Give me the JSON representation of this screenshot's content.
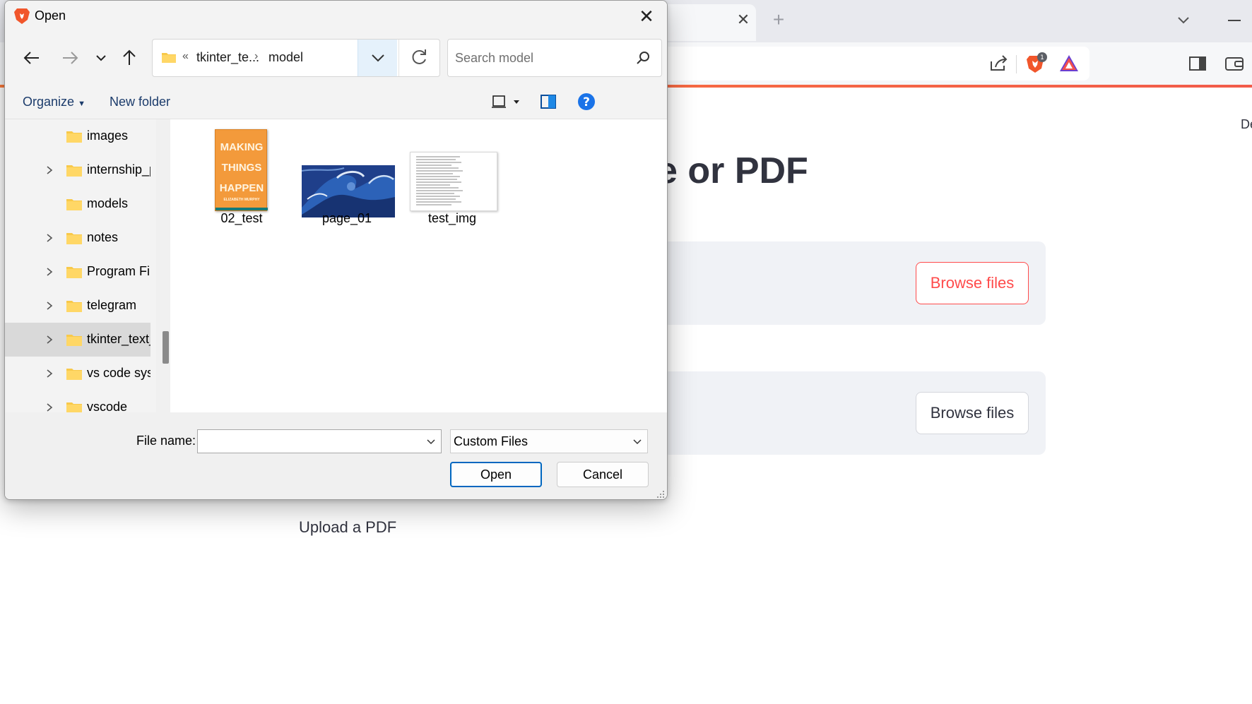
{
  "browser": {
    "tab_close_glyph": "✕",
    "new_tab_glyph": "+",
    "brave_badge": "1"
  },
  "page": {
    "title_fragment": "e or PDF",
    "deploy_fragment": "De",
    "upload_buttons": [
      "Browse files",
      "Browse files"
    ],
    "upload_caption": "Upload a PDF",
    "accent_color": "#ff4b4b"
  },
  "dialog": {
    "title": "Open",
    "address": {
      "overflow": "«",
      "crumbs": [
        "tkinter_te...",
        "model"
      ]
    },
    "search_placeholder": "Search model",
    "commands": {
      "organize": "Organize",
      "new_folder": "New folder"
    },
    "tree": [
      {
        "label": "images",
        "expandable": false,
        "selected": false
      },
      {
        "label": "internship_p",
        "expandable": true,
        "selected": false
      },
      {
        "label": "models",
        "expandable": false,
        "selected": false
      },
      {
        "label": "notes",
        "expandable": true,
        "selected": false
      },
      {
        "label": "Program Fil",
        "expandable": true,
        "selected": false
      },
      {
        "label": "telegram",
        "expandable": true,
        "selected": false
      },
      {
        "label": "tkinter_text_",
        "expandable": true,
        "selected": true
      },
      {
        "label": "vs code sys",
        "expandable": true,
        "selected": false
      },
      {
        "label": "vscode",
        "expandable": true,
        "selected": false
      }
    ],
    "files": [
      {
        "name": "02_test",
        "thumb": "book-cover",
        "cover_lines": [
          "MAKING",
          "THINGS",
          "HAPPEN"
        ],
        "cover_author": "ELIZABETH MURPHY"
      },
      {
        "name": "page_01",
        "thumb": "wave-painting"
      },
      {
        "name": "test_img",
        "thumb": "text-document"
      }
    ],
    "file_name_label": "File name:",
    "file_name_value": "",
    "file_type": "Custom Files",
    "open_label": "Open",
    "cancel_label": "Cancel"
  }
}
